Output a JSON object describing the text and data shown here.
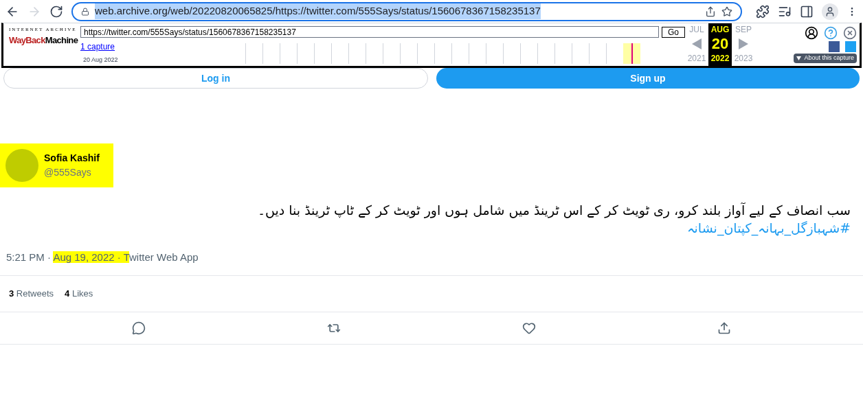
{
  "browser": {
    "url_host": "web.archive.org",
    "url_path": "/web/20220820065825/https://twitter.com/555Says/status/1560678367158235137",
    "url_selected": true
  },
  "wayback": {
    "logo_top": "INTERNET ARCHIVE",
    "logo_a": "WayBack",
    "logo_b": "Machine",
    "url_value": "https://twitter.com/555Says/status/1560678367158235137",
    "go": "Go",
    "captures": "1 capture",
    "capture_date": "20 Aug 2022",
    "months": [
      {
        "label": "JUL",
        "year": "2021",
        "selected": false
      },
      {
        "label": "AUG",
        "day": "20",
        "year": "2022",
        "selected": true
      },
      {
        "label": "SEP",
        "year": "2023",
        "selected": false
      }
    ],
    "about": "About this capture"
  },
  "auth": {
    "login": "Log in",
    "signup": "Sign up"
  },
  "tweet": {
    "name": "Sofia Kashif",
    "handle": "@555Says",
    "header_highlighted": true,
    "text": "سب انصاف کے لیے آواز بلند کرو، ری ٹویٹ کر کے اس ٹرینڈ میں شامل ہوں اور ٹویٹ کر کے ٹاپ ٹرینڈ بنا دیں۔",
    "hashtag": "#شہبازگل_بہانہ_کپتان_نشانہ",
    "meta": [
      {
        "text": "5:21 PM · ",
        "highlighted": false
      },
      {
        "text": "Aug 19, 2022 · T",
        "highlighted": true
      },
      {
        "text": "witter Web App",
        "highlighted": false
      }
    ],
    "stats": [
      {
        "count": "3",
        "label": "Retweets"
      },
      {
        "count": "4",
        "label": "Likes"
      }
    ]
  }
}
